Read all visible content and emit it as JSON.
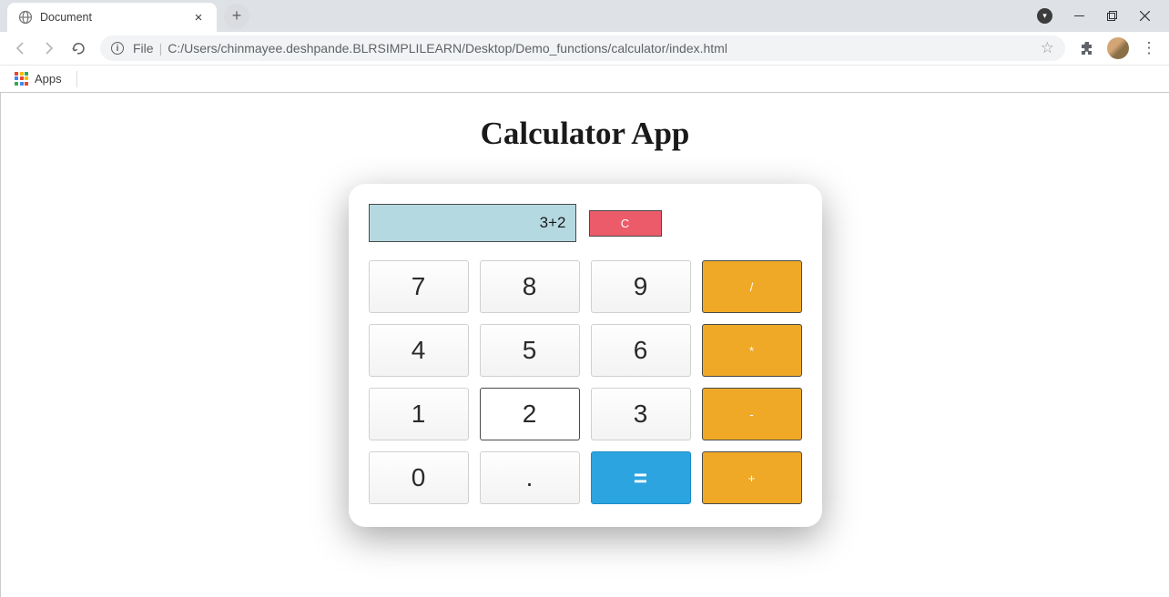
{
  "browser": {
    "tab_title": "Document",
    "address_prefix": "File",
    "address_path": "C:/Users/chinmayee.deshpande.BLRSIMPLILEARN/Desktop/Demo_functions/calculator/index.html",
    "apps_label": "Apps"
  },
  "page": {
    "title": "Calculator App"
  },
  "calculator": {
    "display_value": "3+2",
    "clear_label": "C",
    "buttons": {
      "r0c0": "7",
      "r0c1": "8",
      "r0c2": "9",
      "r0c3": "/",
      "r1c0": "4",
      "r1c1": "5",
      "r1c2": "6",
      "r1c3": "*",
      "r2c0": "1",
      "r2c1": "2",
      "r2c2": "3",
      "r2c3": "-",
      "r3c0": "0",
      "r3c1": ".",
      "r3c2": "=",
      "r3c3": "+"
    }
  }
}
